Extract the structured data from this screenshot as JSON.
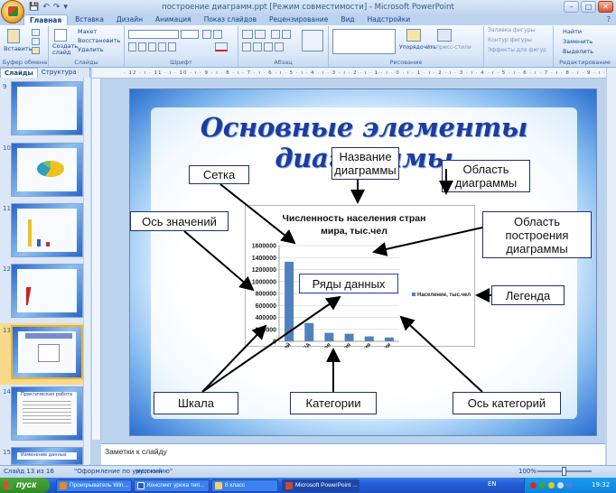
{
  "window": {
    "title": "построение диаграмм.ppt [Режим совместимости] - Microsoft PowerPoint",
    "qat": [
      "💾",
      "↶",
      "↷",
      "▾"
    ],
    "controls": {
      "minimize": "–",
      "maximize": "□",
      "close": "✕"
    }
  },
  "ribbon": {
    "tabs": [
      "Главная",
      "Вставка",
      "Дизайн",
      "Анимация",
      "Показ слайдов",
      "Рецензирование",
      "Вид",
      "Надстройки"
    ],
    "active_tab": "Главная",
    "groups": {
      "clipboard": {
        "label": "Буфер обмена",
        "paste": "Вставить"
      },
      "slides": {
        "label": "Слайды",
        "new_slide": "Создать слайд",
        "layout": "Макет",
        "reset": "Восстановить",
        "delete": "Удалить"
      },
      "font": {
        "label": "Шрифт"
      },
      "paragraph": {
        "label": "Абзац"
      },
      "drawing": {
        "label": "Рисование",
        "arrange": "Упорядочить",
        "quick_styles": "Экспресс-стили",
        "fill": "Заливка фигуры",
        "outline": "Контур фигуры",
        "effects": "Эффекты для фигур"
      },
      "editing": {
        "label": "Редактирование",
        "find": "Найти",
        "replace": "Заменить",
        "select": "Выделить"
      }
    }
  },
  "panes": {
    "tabs": [
      "Слайды",
      "Структура"
    ],
    "thumbnails": [
      "9",
      "10",
      "11",
      "12",
      "13",
      "14",
      "15"
    ],
    "thumb14_title": "Практическая работа",
    "thumb15_title": "Изменение данных"
  },
  "ruler": "· 12 · ı · 11 · ı · 10 · ı · 9 · ı · 8 · ı · 7 · ı · 6 · ı · 5 · ı · 4 · ı · 3 · ı · 2 · ı · 1 · ı · 0 · ı · 1 · ı · 2 · ı · 3 · ı · 4 · ı · 5 · ı · 6 · ı · 7 · ı · 8 · ı · 9 · ı · 10 · ı · 11 · ı · 12 ·",
  "slide": {
    "title": "Основные элементы диаграммы",
    "callouts": {
      "grid": "Сетка",
      "chart_title": "Название диаграммы",
      "chart_area": "Область диаграммы",
      "value_axis": "Ось значений",
      "plot_area": "Область построения диаграммы",
      "data_series": "Ряды данных",
      "legend": "Легенда",
      "scale": "Шкала",
      "categories": "Категории",
      "category_axis": "Ось категорий"
    }
  },
  "chart_data": {
    "type": "bar",
    "title": "Численность населения стран мира, тыс.чел",
    "categories": [
      "Китай",
      "США",
      "Россия",
      "Япония",
      "Германия",
      "Франция"
    ],
    "series": [
      {
        "name": "Население, тыс.чел",
        "values": [
          1330000,
          305000,
          142000,
          127000,
          82000,
          64000
        ]
      }
    ],
    "ylim": [
      0,
      1600000
    ],
    "yticks": [
      "0",
      "200000",
      "400000",
      "600000",
      "800000",
      "1000000",
      "1200000",
      "1400000",
      "1600000"
    ],
    "legend": "right",
    "bar_color": "#4f81bd"
  },
  "notes": {
    "placeholder": "Заметки к слайду"
  },
  "status": {
    "slide": "Слайд 13 из 16",
    "theme": "\"Оформление по умолчанию\"",
    "lang": "русский",
    "zoom": "100%"
  },
  "taskbar": {
    "start": "пуск",
    "tasks": [
      "Проигрыватель Win...",
      "Конспект урока тип...",
      "8 класс",
      "Microsoft PowerPoint ..."
    ],
    "lang": "EN",
    "time": "19:32"
  }
}
